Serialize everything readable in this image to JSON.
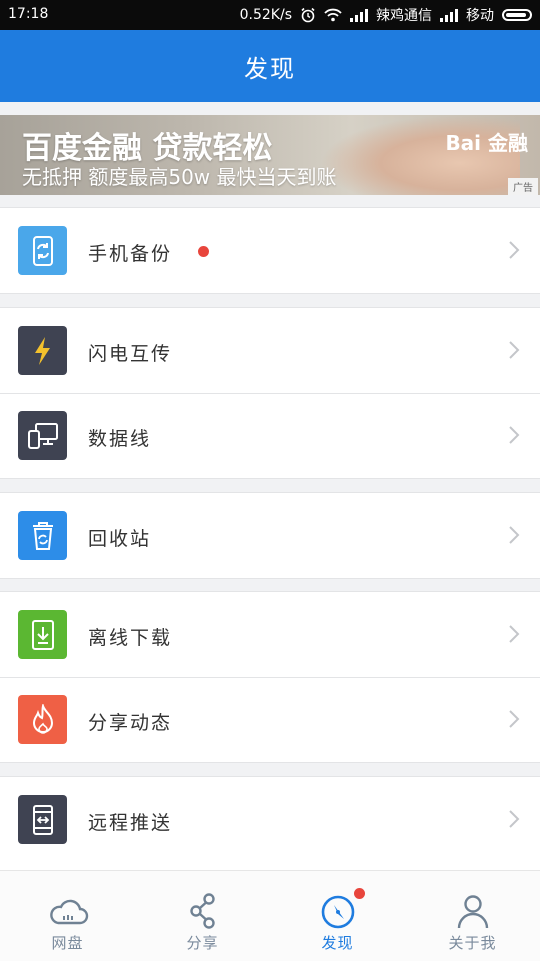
{
  "status_bar": {
    "time": "17:18",
    "speed": "0.52K/s",
    "carrier1": "辣鸡通信",
    "carrier2": "移动"
  },
  "header": {
    "title": "发现"
  },
  "banner": {
    "headline": "百度金融 贷款轻松",
    "subline": "无抵押 额度最高50w 最快当天到账",
    "logo": "Bai 金融",
    "ad_tag": "广告"
  },
  "groups": [
    {
      "items": [
        {
          "label": "手机备份",
          "icon": "phone-sync-icon",
          "color": "#4aa7ea",
          "badge_dot": true
        }
      ]
    },
    {
      "items": [
        {
          "label": "闪电互传",
          "icon": "lightning-icon",
          "color": "#3f4352"
        },
        {
          "label": "数据线",
          "icon": "devices-icon",
          "color": "#3f4352"
        }
      ]
    },
    {
      "items": [
        {
          "label": "回收站",
          "icon": "recycle-bin-icon",
          "color": "#2d8de8"
        }
      ]
    },
    {
      "items": [
        {
          "label": "离线下载",
          "icon": "download-icon",
          "color": "#5bb732"
        },
        {
          "label": "分享动态",
          "icon": "flame-icon",
          "color": "#ef6045"
        }
      ]
    },
    {
      "items": [
        {
          "label": "远程推送",
          "icon": "remote-push-icon",
          "color": "#3f4352"
        }
      ]
    }
  ],
  "bottom_nav": {
    "tabs": [
      {
        "label": "网盘",
        "icon": "cloud-icon"
      },
      {
        "label": "分享",
        "icon": "share-icon"
      },
      {
        "label": "发现",
        "icon": "compass-icon",
        "active": true,
        "badge_dot": true
      },
      {
        "label": "关于我",
        "icon": "person-icon"
      }
    ]
  },
  "colors": {
    "brand_blue": "#1f7cdf",
    "badge_red": "#e8453c",
    "background": "#f1f2f4"
  }
}
